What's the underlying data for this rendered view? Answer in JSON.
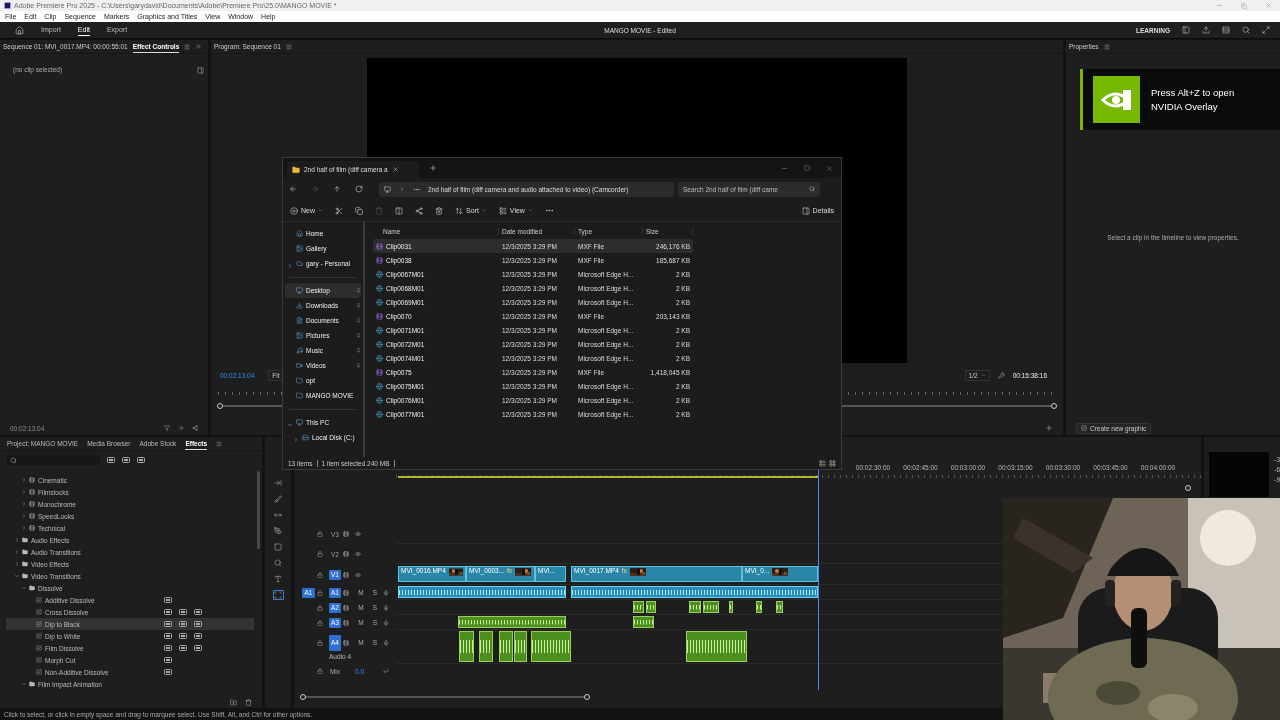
{
  "title_bar": {
    "title": "Adobe Premiere Pro 2025 - C:\\Users\\garydavid\\Documents\\Adobe\\Premiere Pro\\25.0\\MANGO MOVIE *"
  },
  "menu": [
    "File",
    "Edit",
    "Clip",
    "Sequence",
    "Markers",
    "Graphics and Titles",
    "View",
    "Window",
    "Help"
  ],
  "header": {
    "tabs": [
      {
        "label": "Import",
        "selected": false
      },
      {
        "label": "Edit",
        "selected": true
      },
      {
        "label": "Export",
        "selected": false
      }
    ],
    "project_title": "MANGO MOVIE - Edited",
    "learning": "LEARNING"
  },
  "effect_controls": {
    "source": "Sequence 01: MVI_0017.MP4: 00:00:55:01",
    "tab": {
      "label": "Effect Controls",
      "selected": true
    },
    "message": "(no clip selected)",
    "timecode": "00:02:13:04"
  },
  "program_monitor": {
    "title": "Program: Sequence 01",
    "timecode": "00:02:13:04",
    "zoom": "Fit",
    "resolution": "1/2",
    "duration": "00:15:38:16"
  },
  "properties": {
    "title": "Properties",
    "message": "Select a clip in the timeline to view properties.",
    "button": "Create new graphic"
  },
  "overlay": {
    "message": "Press Alt+Z to open NVIDIA Overlay"
  },
  "effects_panel": {
    "tabs": [
      {
        "label": "Project: MANGO MOVIE",
        "selected": false
      },
      {
        "label": "Media Browser",
        "selected": false
      },
      {
        "label": "Adobe Stock",
        "selected": false
      },
      {
        "label": "Effects",
        "selected": true
      }
    ],
    "tree": [
      {
        "kind": "folder",
        "expanded": true,
        "children": [
          {
            "kind": "preset",
            "label": "Cinematic",
            "expanded": false
          },
          {
            "kind": "preset",
            "label": "Filmstocks",
            "expanded": false
          },
          {
            "kind": "preset",
            "label": "Monochrome",
            "expanded": false
          },
          {
            "kind": "preset",
            "label": "SpeedLooks",
            "expanded": false
          },
          {
            "kind": "preset",
            "label": "Technical",
            "expanded": false
          }
        ]
      },
      {
        "kind": "folder",
        "label": "Audio Effects",
        "expanded": false
      },
      {
        "kind": "folder",
        "label": "Audio Transitions",
        "expanded": false
      },
      {
        "kind": "folder",
        "label": "Video Effects",
        "expanded": false
      },
      {
        "kind": "folder",
        "label": "Video Transitions",
        "expanded": true,
        "children": [
          {
            "kind": "folder",
            "label": "Dissolve",
            "expanded": true,
            "children": [
              {
                "kind": "effect",
                "label": "Additive Dissolve",
                "selected": false,
                "accelerated": true,
                "bit32": false,
                "yuv": false
              },
              {
                "kind": "effect",
                "label": "Cross Dissolve",
                "selected": false,
                "accelerated": true,
                "bit32": true,
                "yuv": true
              },
              {
                "kind": "effect",
                "label": "Dip to Black",
                "selected": true,
                "accelerated": true,
                "bit32": true,
                "yuv": true
              },
              {
                "kind": "effect",
                "label": "Dip to White",
                "selected": false,
                "accelerated": true,
                "bit32": true,
                "yuv": true
              },
              {
                "kind": "effect",
                "label": "Film Dissolve",
                "selected": false,
                "accelerated": true,
                "bit32": true,
                "yuv": true
              },
              {
                "kind": "effect",
                "label": "Morph Cut",
                "selected": false,
                "accelerated": true,
                "bit32": false,
                "yuv": false
              },
              {
                "kind": "effect",
                "label": "Non-Additive Dissolve",
                "selected": false,
                "accelerated": true,
                "bit32": false,
                "yuv": false
              }
            ]
          },
          {
            "kind": "folder",
            "label": "Film Impact Animation",
            "expanded": true
          }
        ]
      }
    ]
  },
  "timeline": {
    "tools": [
      {
        "selected": false
      },
      {
        "selected": false
      },
      {
        "selected": false
      },
      {
        "selected": false
      },
      {
        "selected": false
      },
      {
        "selected": false
      },
      {
        "selected": false
      },
      {
        "selected": true
      }
    ],
    "ruler": [
      "00:02:30:00",
      "00:02:45:00",
      "00:03:00:00",
      "00:03:15:00",
      "00:03:30:00",
      "00:03:45:00",
      "00:04:00:00"
    ],
    "tracks": [
      {
        "kind": "video",
        "name": "V3",
        "targeted": false
      },
      {
        "kind": "video",
        "name": "V2",
        "targeted": false
      },
      {
        "kind": "video",
        "name": "V1",
        "targeted": true
      },
      {
        "kind": "audio",
        "name": "A1",
        "targeted": true,
        "patch": "A1",
        "mute": "M",
        "solo": "S"
      },
      {
        "kind": "audio",
        "name": "A2",
        "targeted": true,
        "mute": "M",
        "solo": "S"
      },
      {
        "kind": "audio",
        "name": "A3",
        "targeted": true,
        "mute": "M",
        "solo": "S"
      },
      {
        "kind": "audio",
        "name": "A4",
        "targeted": true,
        "label": "Audio 4",
        "mute": "M",
        "solo": "S"
      },
      {
        "kind": "mix",
        "name": "Mix",
        "value": "0.0"
      }
    ],
    "video_clips": [
      {
        "label": "MVI_0016.MP4"
      },
      {
        "label": "MVI_0003...",
        "badge": "fx"
      },
      {
        "label": "MVI..."
      },
      {
        "label": "MVI_0017.MP4",
        "badge": "fx"
      },
      {
        "label": "MVI_0..."
      }
    ]
  },
  "meter": {
    "scale": [
      "-3",
      "-6",
      "-9"
    ]
  },
  "explorer": {
    "tab": "2nd half of film (diff camera a",
    "address": "2nd half of film (diff camera and audio attached to video) (Camcorder)",
    "search": {
      "placeholder": "Search 2nd half of film (diff came"
    },
    "forward_disabled": true,
    "paste_disabled": true,
    "toolbar": {
      "new": "New",
      "sort": "Sort",
      "view": "View",
      "details": "Details"
    },
    "nav_sections": [
      [
        {
          "kind": "plain",
          "label": "Home",
          "selected": false
        },
        {
          "kind": "plain",
          "label": "Gallery",
          "selected": false
        },
        {
          "kind": "branch",
          "label": "gary - Personal",
          "selected": false,
          "expanded": false
        }
      ],
      [
        {
          "kind": "pinned",
          "label": "Desktop",
          "selected": true
        },
        {
          "kind": "pinned",
          "label": "Downloads",
          "selected": false
        },
        {
          "kind": "pinned",
          "label": "Documents",
          "selected": false
        },
        {
          "kind": "pinned",
          "label": "Pictures",
          "selected": false
        },
        {
          "kind": "pinned",
          "label": "Music",
          "selected": false
        },
        {
          "kind": "pinned",
          "label": "Videos",
          "selected": false
        },
        {
          "kind": "plain",
          "label": "opt",
          "selected": false
        },
        {
          "kind": "plain",
          "label": "MANGO MOVIE",
          "selected": false
        }
      ],
      [
        {
          "kind": "branch",
          "label": "This PC",
          "selected": false,
          "expanded": true,
          "children": [
            {
              "kind": "branch",
              "label": "Local Disk (C:)",
              "selected": false,
              "expanded": false
            }
          ]
        }
      ]
    ],
    "columns": [
      "Name",
      "Date modified",
      "Type",
      "Size"
    ],
    "files": [
      {
        "kind": "video",
        "name": "Clip0031",
        "date": "12/3/2025 3:29 PM",
        "type": "MXF File",
        "size": "246,176 KB",
        "selected": true
      },
      {
        "kind": "video",
        "name": "Clip0038",
        "date": "12/3/2025 3:29 PM",
        "type": "MXF File",
        "size": "185,687 KB",
        "selected": false
      },
      {
        "kind": "web",
        "name": "Clip0067M01",
        "date": "12/3/2025 3:29 PM",
        "type": "Microsoft Edge H...",
        "size": "2 KB",
        "selected": false
      },
      {
        "kind": "web",
        "name": "Clip0068M01",
        "date": "12/3/2025 3:29 PM",
        "type": "Microsoft Edge H...",
        "size": "2 KB",
        "selected": false
      },
      {
        "kind": "web",
        "name": "Clip0069M01",
        "date": "12/3/2025 3:29 PM",
        "type": "Microsoft Edge H...",
        "size": "2 KB",
        "selected": false
      },
      {
        "kind": "video",
        "name": "Clip0070",
        "date": "12/3/2025 3:29 PM",
        "type": "MXF File",
        "size": "203,143 KB",
        "selected": false
      },
      {
        "kind": "web",
        "name": "Clip0071M01",
        "date": "12/3/2025 3:29 PM",
        "type": "Microsoft Edge H...",
        "size": "2 KB",
        "selected": false
      },
      {
        "kind": "web",
        "name": "Clip0072M01",
        "date": "12/3/2025 3:29 PM",
        "type": "Microsoft Edge H...",
        "size": "2 KB",
        "selected": false
      },
      {
        "kind": "web",
        "name": "Clip0074M01",
        "date": "12/3/2025 3:29 PM",
        "type": "Microsoft Edge H...",
        "size": "2 KB",
        "selected": false
      },
      {
        "kind": "video",
        "name": "Clip0075",
        "date": "12/3/2025 3:29 PM",
        "type": "MXF File",
        "size": "1,418,045 KB",
        "selected": false
      },
      {
        "kind": "web",
        "name": "Clip0075M01",
        "date": "12/3/2025 3:29 PM",
        "type": "Microsoft Edge H...",
        "size": "2 KB",
        "selected": false
      },
      {
        "kind": "web",
        "name": "Clip0076M01",
        "date": "12/3/2025 3:29 PM",
        "type": "Microsoft Edge H...",
        "size": "2 KB",
        "selected": false
      },
      {
        "kind": "web",
        "name": "Clip0077M01",
        "date": "12/3/2025 3:29 PM",
        "type": "Microsoft Edge H...",
        "size": "2 KB",
        "selected": false
      }
    ],
    "status": {
      "count": "13 items",
      "selection": "1 item selected  240 MB"
    }
  },
  "status_bar": "Click to select, or click in empty space and drag to marquee select. Use Shift, Alt, and Ctrl for other options."
}
